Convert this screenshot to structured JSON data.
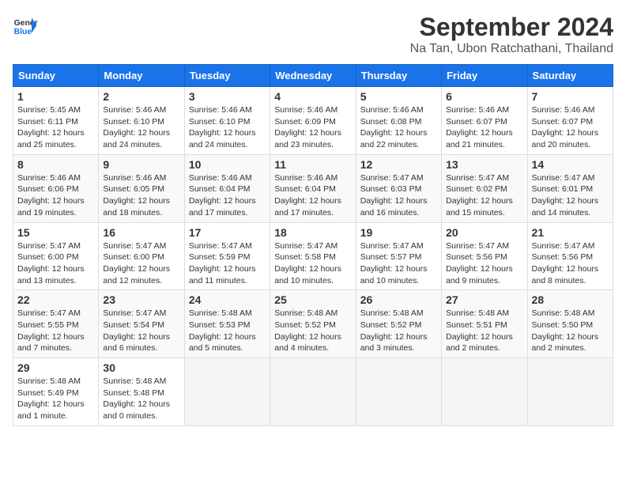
{
  "header": {
    "logo_line1": "General",
    "logo_line2": "Blue",
    "month": "September 2024",
    "location": "Na Tan, Ubon Ratchathani, Thailand"
  },
  "weekdays": [
    "Sunday",
    "Monday",
    "Tuesday",
    "Wednesday",
    "Thursday",
    "Friday",
    "Saturday"
  ],
  "weeks": [
    [
      {
        "day": "1",
        "sunrise": "5:45 AM",
        "sunset": "6:11 PM",
        "daylight": "12 hours and 25 minutes."
      },
      {
        "day": "2",
        "sunrise": "5:46 AM",
        "sunset": "6:10 PM",
        "daylight": "12 hours and 24 minutes."
      },
      {
        "day": "3",
        "sunrise": "5:46 AM",
        "sunset": "6:10 PM",
        "daylight": "12 hours and 24 minutes."
      },
      {
        "day": "4",
        "sunrise": "5:46 AM",
        "sunset": "6:09 PM",
        "daylight": "12 hours and 23 minutes."
      },
      {
        "day": "5",
        "sunrise": "5:46 AM",
        "sunset": "6:08 PM",
        "daylight": "12 hours and 22 minutes."
      },
      {
        "day": "6",
        "sunrise": "5:46 AM",
        "sunset": "6:07 PM",
        "daylight": "12 hours and 21 minutes."
      },
      {
        "day": "7",
        "sunrise": "5:46 AM",
        "sunset": "6:07 PM",
        "daylight": "12 hours and 20 minutes."
      }
    ],
    [
      {
        "day": "8",
        "sunrise": "5:46 AM",
        "sunset": "6:06 PM",
        "daylight": "12 hours and 19 minutes."
      },
      {
        "day": "9",
        "sunrise": "5:46 AM",
        "sunset": "6:05 PM",
        "daylight": "12 hours and 18 minutes."
      },
      {
        "day": "10",
        "sunrise": "5:46 AM",
        "sunset": "6:04 PM",
        "daylight": "12 hours and 17 minutes."
      },
      {
        "day": "11",
        "sunrise": "5:46 AM",
        "sunset": "6:04 PM",
        "daylight": "12 hours and 17 minutes."
      },
      {
        "day": "12",
        "sunrise": "5:47 AM",
        "sunset": "6:03 PM",
        "daylight": "12 hours and 16 minutes."
      },
      {
        "day": "13",
        "sunrise": "5:47 AM",
        "sunset": "6:02 PM",
        "daylight": "12 hours and 15 minutes."
      },
      {
        "day": "14",
        "sunrise": "5:47 AM",
        "sunset": "6:01 PM",
        "daylight": "12 hours and 14 minutes."
      }
    ],
    [
      {
        "day": "15",
        "sunrise": "5:47 AM",
        "sunset": "6:00 PM",
        "daylight": "12 hours and 13 minutes."
      },
      {
        "day": "16",
        "sunrise": "5:47 AM",
        "sunset": "6:00 PM",
        "daylight": "12 hours and 12 minutes."
      },
      {
        "day": "17",
        "sunrise": "5:47 AM",
        "sunset": "5:59 PM",
        "daylight": "12 hours and 11 minutes."
      },
      {
        "day": "18",
        "sunrise": "5:47 AM",
        "sunset": "5:58 PM",
        "daylight": "12 hours and 10 minutes."
      },
      {
        "day": "19",
        "sunrise": "5:47 AM",
        "sunset": "5:57 PM",
        "daylight": "12 hours and 10 minutes."
      },
      {
        "day": "20",
        "sunrise": "5:47 AM",
        "sunset": "5:56 PM",
        "daylight": "12 hours and 9 minutes."
      },
      {
        "day": "21",
        "sunrise": "5:47 AM",
        "sunset": "5:56 PM",
        "daylight": "12 hours and 8 minutes."
      }
    ],
    [
      {
        "day": "22",
        "sunrise": "5:47 AM",
        "sunset": "5:55 PM",
        "daylight": "12 hours and 7 minutes."
      },
      {
        "day": "23",
        "sunrise": "5:47 AM",
        "sunset": "5:54 PM",
        "daylight": "12 hours and 6 minutes."
      },
      {
        "day": "24",
        "sunrise": "5:48 AM",
        "sunset": "5:53 PM",
        "daylight": "12 hours and 5 minutes."
      },
      {
        "day": "25",
        "sunrise": "5:48 AM",
        "sunset": "5:52 PM",
        "daylight": "12 hours and 4 minutes."
      },
      {
        "day": "26",
        "sunrise": "5:48 AM",
        "sunset": "5:52 PM",
        "daylight": "12 hours and 3 minutes."
      },
      {
        "day": "27",
        "sunrise": "5:48 AM",
        "sunset": "5:51 PM",
        "daylight": "12 hours and 2 minutes."
      },
      {
        "day": "28",
        "sunrise": "5:48 AM",
        "sunset": "5:50 PM",
        "daylight": "12 hours and 2 minutes."
      }
    ],
    [
      {
        "day": "29",
        "sunrise": "5:48 AM",
        "sunset": "5:49 PM",
        "daylight": "12 hours and 1 minute."
      },
      {
        "day": "30",
        "sunrise": "5:48 AM",
        "sunset": "5:48 PM",
        "daylight": "12 hours and 0 minutes."
      },
      null,
      null,
      null,
      null,
      null
    ]
  ]
}
